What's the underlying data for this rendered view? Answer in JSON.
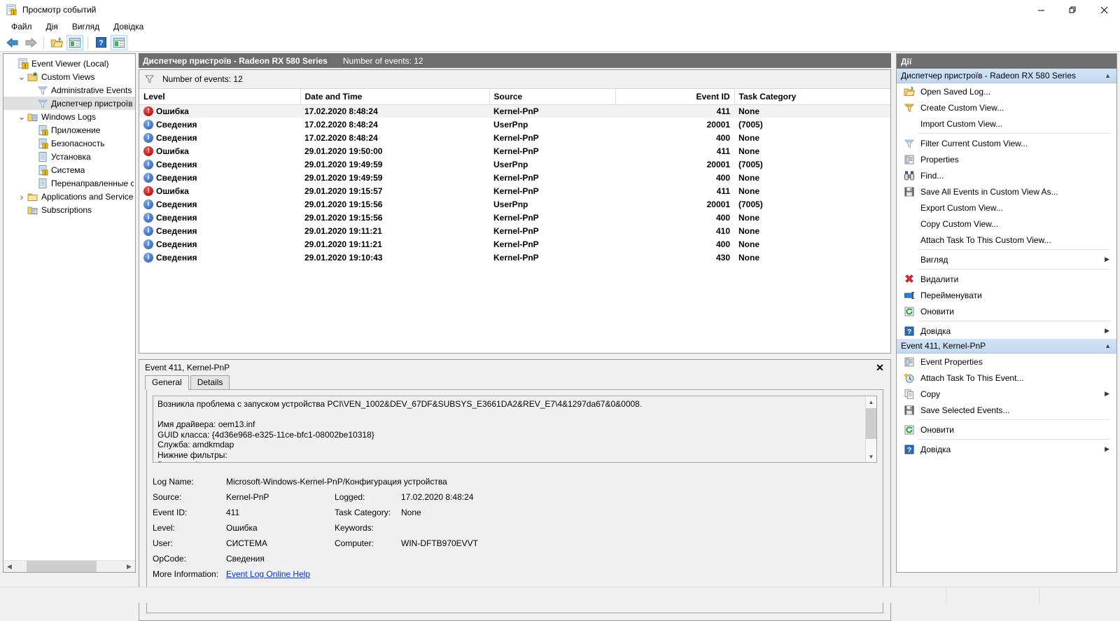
{
  "window": {
    "title": "Просмотр событий",
    "icon": "event-viewer-icon",
    "minimize": "—",
    "maximize": "❐",
    "close": "✕"
  },
  "menu": {
    "items": [
      {
        "label": "Файл"
      },
      {
        "label": "Дія"
      },
      {
        "label": "Вигляд"
      },
      {
        "label": "Довідка"
      }
    ]
  },
  "toolbar": {
    "buttons": [
      {
        "name": "back-button",
        "icon": "left-arrow-icon"
      },
      {
        "name": "forward-button",
        "icon": "right-arrow-icon"
      },
      {
        "name": "open-saved-log-button",
        "icon": "open-folder-icon"
      },
      {
        "name": "show-hide-console-tree-button",
        "icon": "console-tree-icon"
      },
      {
        "name": "help-button",
        "icon": "question-mark-icon"
      },
      {
        "name": "show-hide-action-pane-button",
        "icon": "action-pane-icon"
      }
    ]
  },
  "tree": {
    "items": [
      {
        "label": "Event Viewer (Local)",
        "indent": 0,
        "twisty": "",
        "icon": "event-viewer-icon",
        "selected": false
      },
      {
        "label": "Custom Views",
        "indent": 1,
        "twisty": "v",
        "icon": "folder-custom-icon",
        "selected": false
      },
      {
        "label": "Administrative Events",
        "indent": 2,
        "twisty": "",
        "icon": "filter-icon",
        "selected": false
      },
      {
        "label": "Диспетчер пристроїв -",
        "indent": 2,
        "twisty": "",
        "icon": "filter-icon",
        "selected": true
      },
      {
        "label": "Windows Logs",
        "indent": 1,
        "twisty": "v",
        "icon": "folder-logs-icon",
        "selected": false
      },
      {
        "label": "Приложение",
        "indent": 2,
        "twisty": "",
        "icon": "log-icon",
        "selected": false
      },
      {
        "label": "Безопасность",
        "indent": 2,
        "twisty": "",
        "icon": "log-icon",
        "selected": false
      },
      {
        "label": "Установка",
        "indent": 2,
        "twisty": "",
        "icon": "log-plain-icon",
        "selected": false
      },
      {
        "label": "Система",
        "indent": 2,
        "twisty": "",
        "icon": "log-icon",
        "selected": false
      },
      {
        "label": "Перенаправленные соб",
        "indent": 2,
        "twisty": "",
        "icon": "log-plain-icon",
        "selected": false
      },
      {
        "label": "Applications and Services Lo",
        "indent": 1,
        "twisty": ">",
        "icon": "folder-plain-icon",
        "selected": false
      },
      {
        "label": "Subscriptions",
        "indent": 1,
        "twisty": "",
        "icon": "subscriptions-icon",
        "selected": false
      }
    ]
  },
  "center": {
    "header_title": "Диспетчер пристроїв - Radeon RX 580 Series",
    "header_count": "Number of events: 12",
    "filter_text": "Number of events: 12",
    "columns": [
      {
        "label": "Level",
        "align": "left"
      },
      {
        "label": "Date and Time",
        "align": "left"
      },
      {
        "label": "Source",
        "align": "left"
      },
      {
        "label": "Event ID",
        "align": "right"
      },
      {
        "label": "Task Category",
        "align": "left"
      }
    ],
    "rows": [
      {
        "level": "Ошибка",
        "level_icon": "error-icon",
        "datetime": "17.02.2020 8:48:24",
        "source": "Kernel-PnP",
        "event_id": "411",
        "task_category": "None",
        "selected": true
      },
      {
        "level": "Сведения",
        "level_icon": "information-icon",
        "datetime": "17.02.2020 8:48:24",
        "source": "UserPnp",
        "event_id": "20001",
        "task_category": "(7005)",
        "selected": false
      },
      {
        "level": "Сведения",
        "level_icon": "information-icon",
        "datetime": "17.02.2020 8:48:24",
        "source": "Kernel-PnP",
        "event_id": "400",
        "task_category": "None",
        "selected": false
      },
      {
        "level": "Ошибка",
        "level_icon": "error-icon",
        "datetime": "29.01.2020 19:50:00",
        "source": "Kernel-PnP",
        "event_id": "411",
        "task_category": "None",
        "selected": false
      },
      {
        "level": "Сведения",
        "level_icon": "information-icon",
        "datetime": "29.01.2020 19:49:59",
        "source": "UserPnp",
        "event_id": "20001",
        "task_category": "(7005)",
        "selected": false
      },
      {
        "level": "Сведения",
        "level_icon": "information-icon",
        "datetime": "29.01.2020 19:49:59",
        "source": "Kernel-PnP",
        "event_id": "400",
        "task_category": "None",
        "selected": false
      },
      {
        "level": "Ошибка",
        "level_icon": "error-icon",
        "datetime": "29.01.2020 19:15:57",
        "source": "Kernel-PnP",
        "event_id": "411",
        "task_category": "None",
        "selected": false
      },
      {
        "level": "Сведения",
        "level_icon": "information-icon",
        "datetime": "29.01.2020 19:15:56",
        "source": "UserPnp",
        "event_id": "20001",
        "task_category": "(7005)",
        "selected": false
      },
      {
        "level": "Сведения",
        "level_icon": "information-icon",
        "datetime": "29.01.2020 19:15:56",
        "source": "Kernel-PnP",
        "event_id": "400",
        "task_category": "None",
        "selected": false
      },
      {
        "level": "Сведения",
        "level_icon": "information-icon",
        "datetime": "29.01.2020 19:11:21",
        "source": "Kernel-PnP",
        "event_id": "410",
        "task_category": "None",
        "selected": false
      },
      {
        "level": "Сведения",
        "level_icon": "information-icon",
        "datetime": "29.01.2020 19:11:21",
        "source": "Kernel-PnP",
        "event_id": "400",
        "task_category": "None",
        "selected": false
      },
      {
        "level": "Сведения",
        "level_icon": "information-icon",
        "datetime": "29.01.2020 19:10:43",
        "source": "Kernel-PnP",
        "event_id": "430",
        "task_category": "None",
        "selected": false
      }
    ]
  },
  "detail": {
    "title": "Event 411, Kernel-PnP",
    "close_label": "✕",
    "tabs": [
      {
        "label": "General",
        "active": true
      },
      {
        "label": "Details",
        "active": false
      }
    ],
    "description": "Возникла проблема с запуском устройства PCI\\VEN_1002&DEV_67DF&SUBSYS_E3661DA2&REV_E7\\4&1297da67&0&0008.\n\nИмя драйвера: oem13.inf\nGUID класса: {4d36e968-e325-11ce-bfc1-08002be10318}\nСлужба: amdkmdap\nНижние фильтры:\nВерхние фильтры:",
    "fields": {
      "log_name_label": "Log Name:",
      "log_name_value": "Microsoft-Windows-Kernel-PnP/Конфигурация устройства",
      "source_label": "Source:",
      "source_value": "Kernel-PnP",
      "logged_label": "Logged:",
      "logged_value": "17.02.2020 8:48:24",
      "event_id_label": "Event ID:",
      "event_id_value": "411",
      "task_category_label": "Task Category:",
      "task_category_value": "None",
      "level_label": "Level:",
      "level_value": "Ошибка",
      "keywords_label": "Keywords:",
      "keywords_value": "",
      "user_label": "User:",
      "user_value": "СИСТЕМА",
      "computer_label": "Computer:",
      "computer_value": "WIN-DFTB970EVVT",
      "opcode_label": "OpCode:",
      "opcode_value": "Сведения",
      "more_info_label": "More Information:",
      "more_info_link": "Event Log Online Help"
    }
  },
  "actions": {
    "header": "Дії",
    "group1": {
      "title": "Диспетчер пристроїв - Radeon RX 580 Series",
      "collapse_icon": "chevron-up-icon",
      "items": [
        {
          "label": "Open Saved Log...",
          "icon": "open-folder-icon",
          "submenu": false,
          "sep_after": false
        },
        {
          "label": "Create Custom View...",
          "icon": "filter-amber-icon",
          "submenu": false,
          "sep_after": false
        },
        {
          "label": "Import Custom View...",
          "icon": "",
          "submenu": false,
          "sep_after": true
        },
        {
          "label": "Filter Current Custom View...",
          "icon": "filter-icon",
          "submenu": false,
          "sep_after": false
        },
        {
          "label": "Properties",
          "icon": "properties-icon",
          "submenu": false,
          "sep_after": false
        },
        {
          "label": "Find...",
          "icon": "binoculars-icon",
          "submenu": false,
          "sep_after": false
        },
        {
          "label": "Save All Events in Custom View As...",
          "icon": "save-icon",
          "submenu": false,
          "sep_after": false
        },
        {
          "label": "Export Custom View...",
          "icon": "",
          "submenu": false,
          "sep_after": false
        },
        {
          "label": "Copy Custom View...",
          "icon": "",
          "submenu": false,
          "sep_after": false
        },
        {
          "label": "Attach Task To This Custom View...",
          "icon": "",
          "submenu": false,
          "sep_after": true
        },
        {
          "label": "Вигляд",
          "icon": "",
          "submenu": true,
          "sep_after": true
        },
        {
          "label": "Видалити",
          "icon": "delete-x-icon",
          "submenu": false,
          "sep_after": false
        },
        {
          "label": "Перейменувати",
          "icon": "rename-icon",
          "submenu": false,
          "sep_after": false
        },
        {
          "label": "Оновити",
          "icon": "refresh-icon",
          "submenu": false,
          "sep_after": true
        },
        {
          "label": "Довідка",
          "icon": "help-icon",
          "submenu": true,
          "sep_after": false
        }
      ]
    },
    "group2": {
      "title": "Event 411, Kernel-PnP",
      "collapse_icon": "chevron-up-icon",
      "items": [
        {
          "label": "Event Properties",
          "icon": "properties-icon",
          "submenu": false,
          "sep_after": false
        },
        {
          "label": "Attach Task To This Event...",
          "icon": "attach-task-icon",
          "submenu": false,
          "sep_after": false
        },
        {
          "label": "Copy",
          "icon": "copy-icon",
          "submenu": true,
          "sep_after": false
        },
        {
          "label": "Save Selected Events...",
          "icon": "save-icon",
          "submenu": false,
          "sep_after": true
        },
        {
          "label": "Оновити",
          "icon": "refresh-icon",
          "submenu": false,
          "sep_after": true
        },
        {
          "label": "Довідка",
          "icon": "help-icon",
          "submenu": true,
          "sep_after": false
        }
      ]
    }
  }
}
